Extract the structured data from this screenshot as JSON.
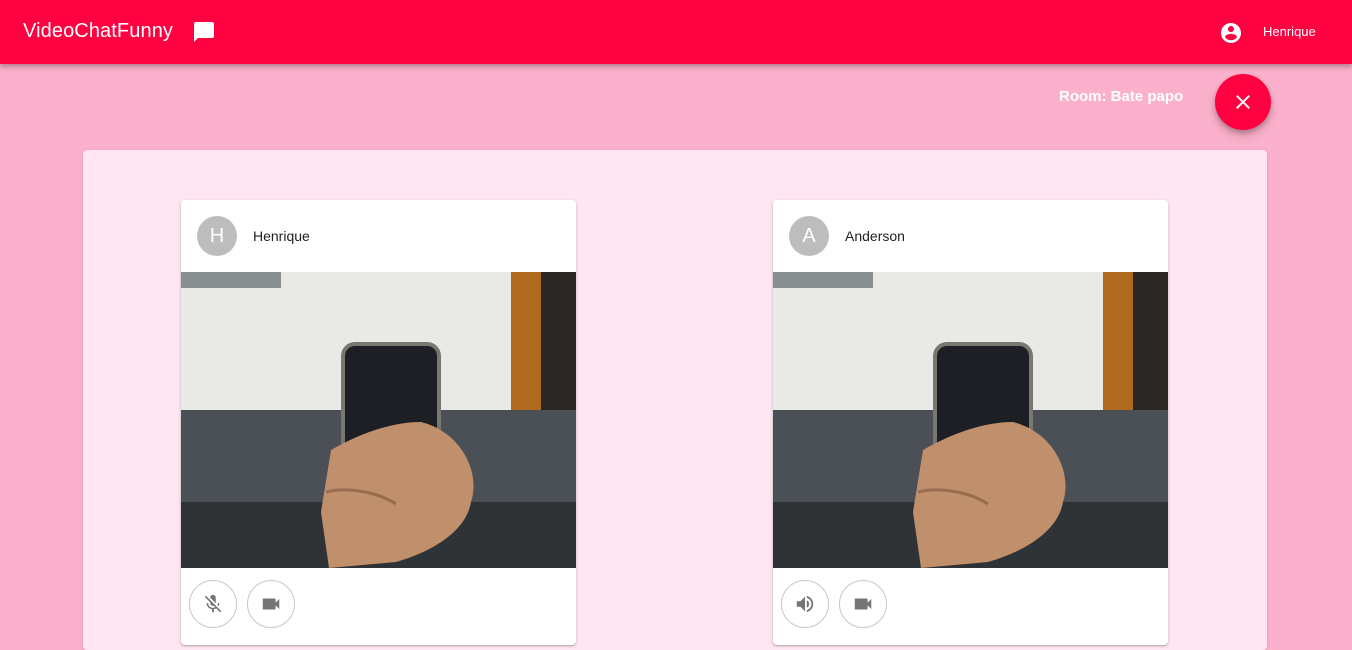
{
  "appbar": {
    "title": "VideoChatFunny",
    "chat_icon": "chat-bubble-icon",
    "user_icon": "account-circle-icon",
    "user_name": "Henrique",
    "color": "#ff0040"
  },
  "room": {
    "label": "Room: Bate papo",
    "close_icon": "close-icon"
  },
  "participants": [
    {
      "initial": "H",
      "name": "Henrique",
      "controls": [
        {
          "icon": "mic-off-icon"
        },
        {
          "icon": "videocam-icon"
        }
      ]
    },
    {
      "initial": "A",
      "name": "Anderson",
      "controls": [
        {
          "icon": "volume-up-icon"
        },
        {
          "icon": "videocam-icon"
        }
      ]
    }
  ],
  "colors": {
    "background": "#fbb0cb",
    "panel": "#ffe6f1",
    "accent": "#ff0040"
  }
}
